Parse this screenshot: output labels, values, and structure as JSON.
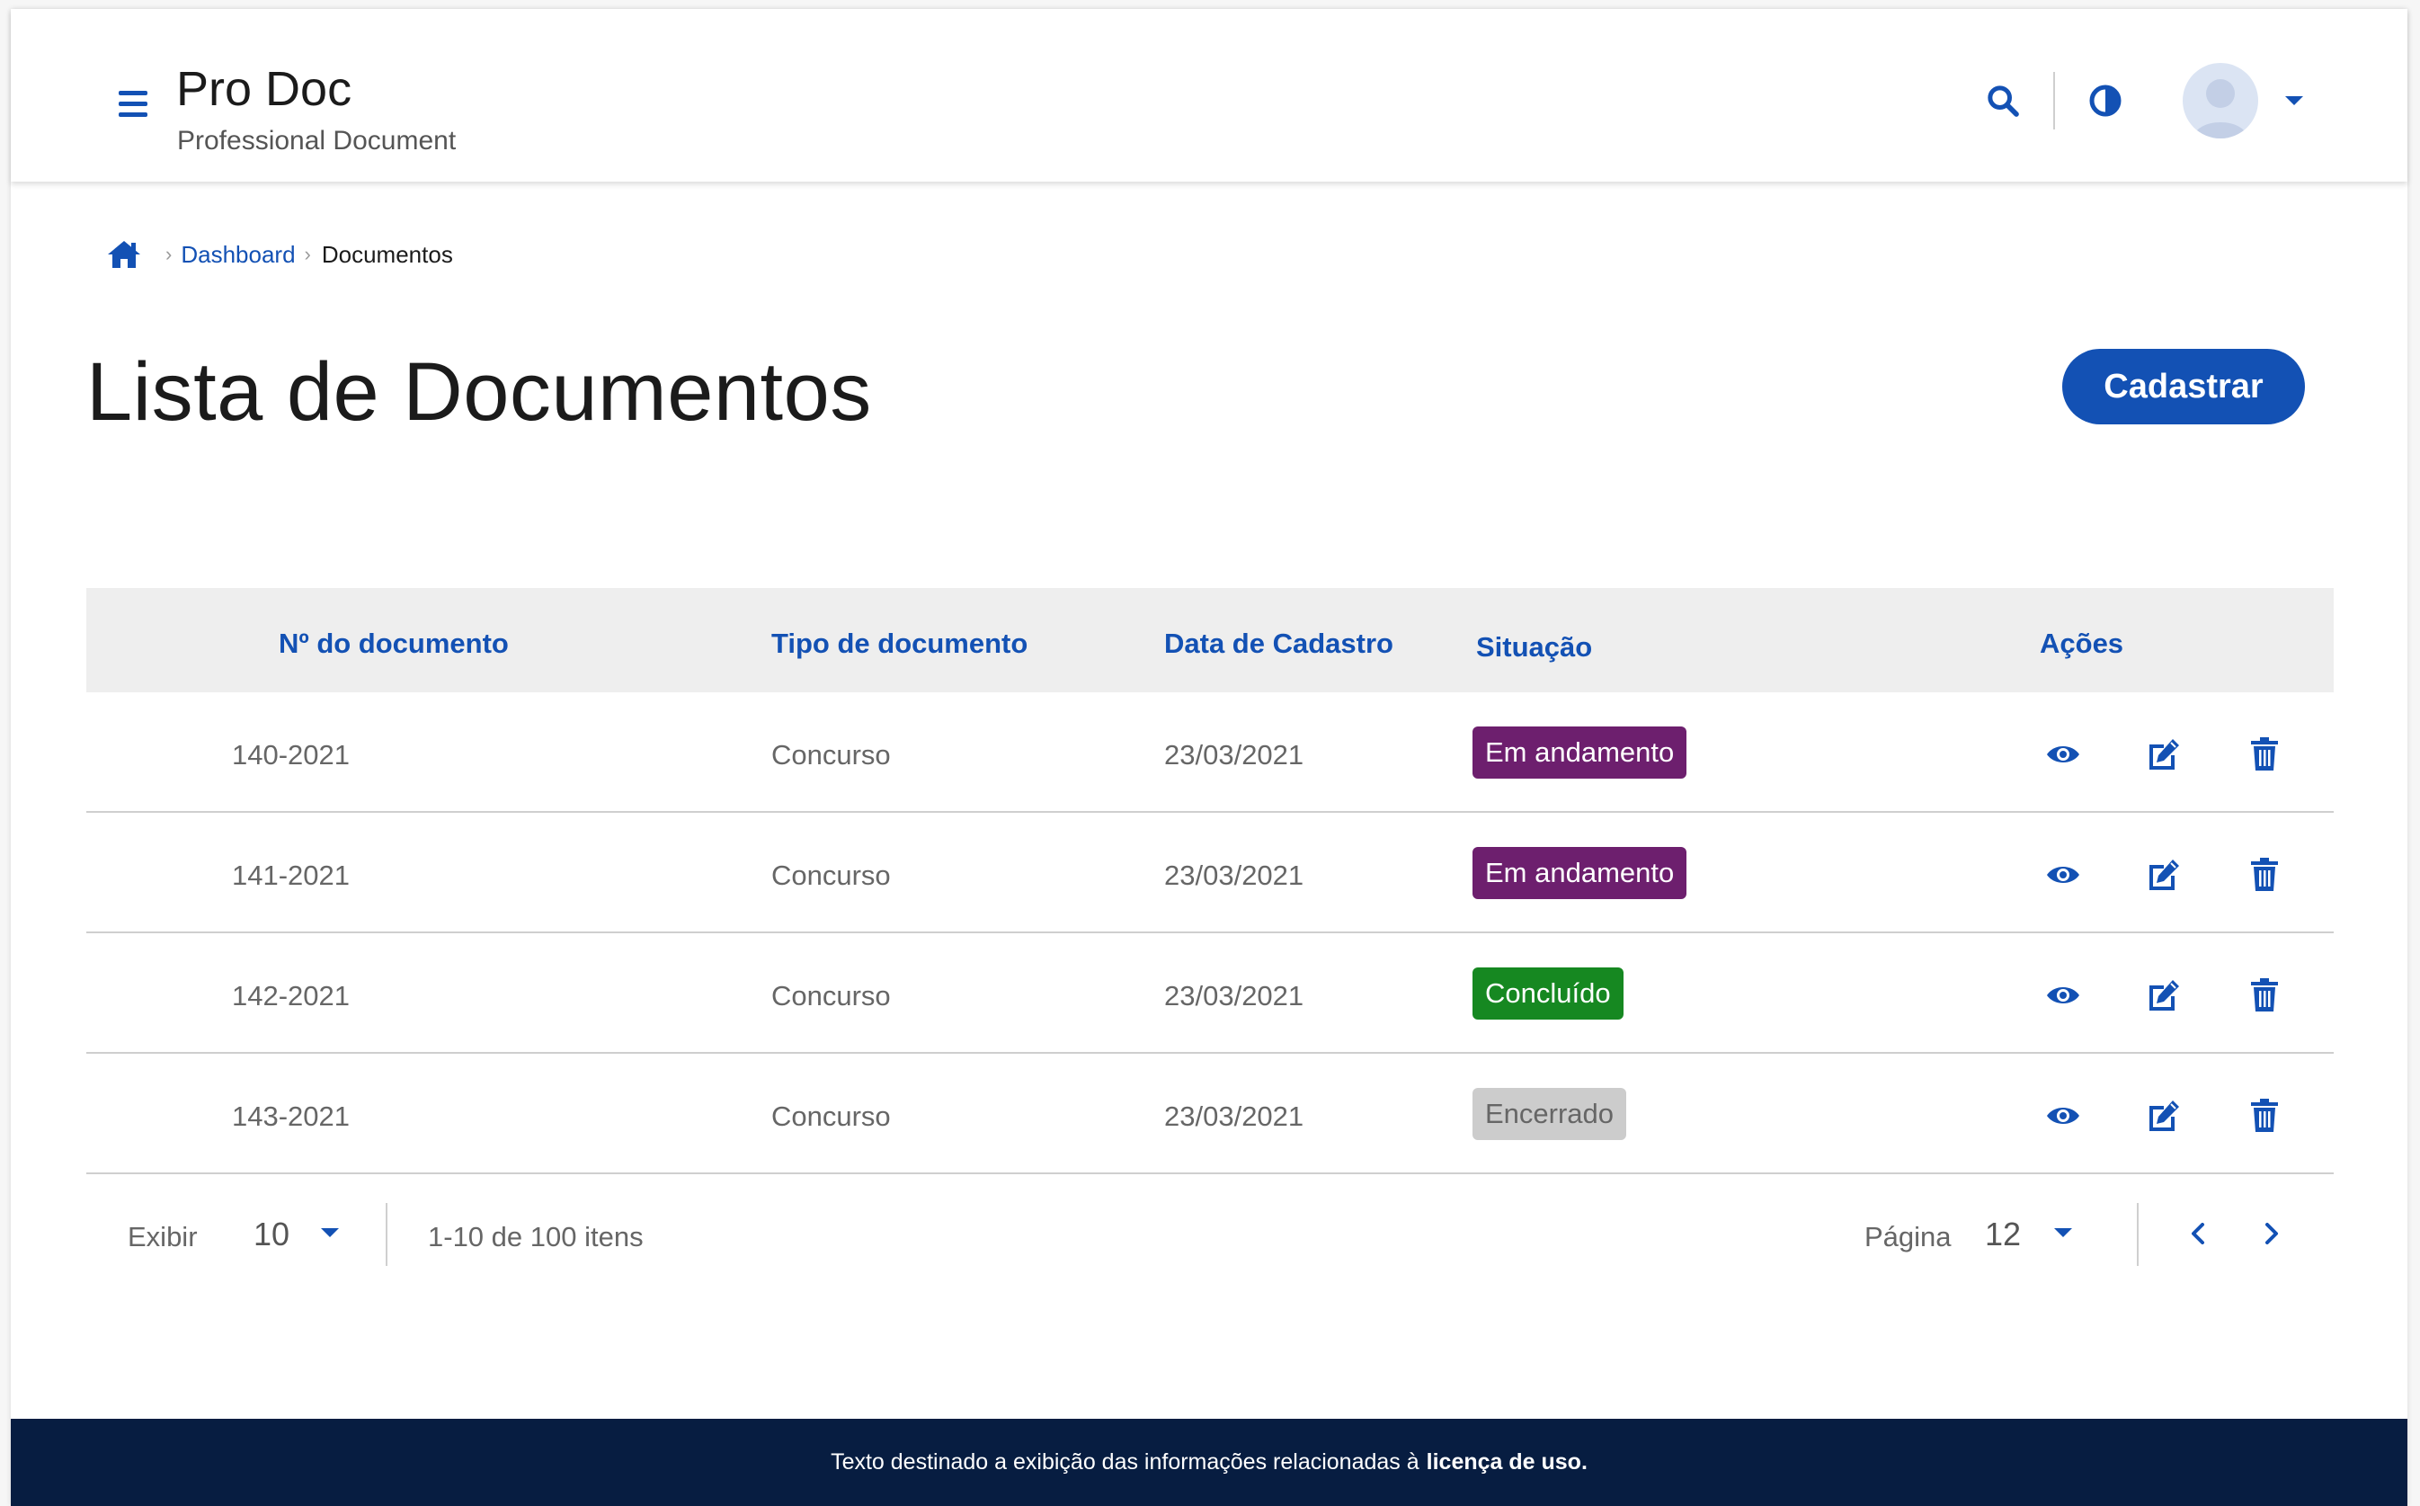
{
  "app": {
    "title": "Pro Doc",
    "subtitle": "Professional Document"
  },
  "header": {
    "icons": [
      "menu-icon",
      "search-icon",
      "contrast-icon",
      "avatar-icon",
      "caret-down-icon"
    ]
  },
  "breadcrumb": {
    "link": "Dashboard",
    "current": "Documentos"
  },
  "main": {
    "title": "Lista de Documentos",
    "primary_button": "Cadastrar"
  },
  "table": {
    "columns": [
      "Nº do documento",
      "Tipo de documento",
      "Data de Cadastro",
      "Situação",
      "Ações"
    ],
    "rows": [
      {
        "numero": "140-2021",
        "tipo": "Concurso",
        "data": "23/03/2021",
        "situacao": "Em andamento",
        "status_color": "#6d1f6e"
      },
      {
        "numero": "141-2021",
        "tipo": "Concurso",
        "data": "23/03/2021",
        "situacao": "Em andamento",
        "status_color": "#6d1f6e"
      },
      {
        "numero": "142-2021",
        "tipo": "Concurso",
        "data": "23/03/2021",
        "situacao": "Concluído",
        "status_color": "#168821"
      },
      {
        "numero": "143-2021",
        "tipo": "Concurso",
        "data": "23/03/2021",
        "situacao": "Encerrado",
        "status_color": "#cccccc"
      }
    ],
    "row_action_icons": [
      "eye-icon",
      "edit-icon",
      "trash-icon"
    ]
  },
  "pagination": {
    "show_label": "Exibir",
    "per_page": "10",
    "range_text": "1-10 de 100 itens",
    "page_label": "Página",
    "page": "12"
  },
  "footer": {
    "text": "Texto destinado a exibição das informações relacionadas à",
    "bold": "licença de uso."
  },
  "colors": {
    "primary": "#1351b4",
    "footer_bg": "#071d41",
    "header_bg": "#eeeeee"
  }
}
